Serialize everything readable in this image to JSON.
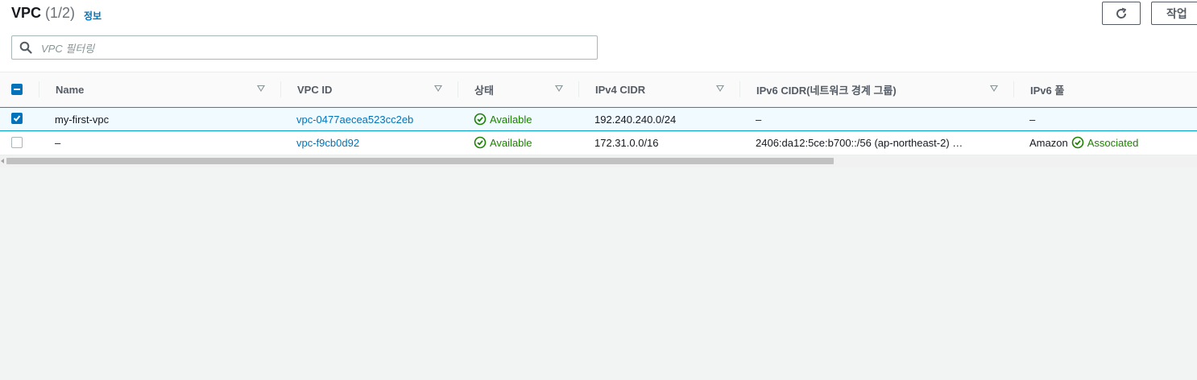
{
  "header": {
    "title": "VPC",
    "count": "(1/2)",
    "info_link": "정보",
    "refresh_icon": "refresh-icon",
    "actions_label": "작업"
  },
  "search": {
    "placeholder": "VPC 필터링",
    "value": ""
  },
  "columns": [
    {
      "label": "Name"
    },
    {
      "label": "VPC ID"
    },
    {
      "label": "상태"
    },
    {
      "label": "IPv4 CIDR"
    },
    {
      "label": "IPv6 CIDR(네트워크 경계 그룹)"
    },
    {
      "label": "IPv6 풀"
    }
  ],
  "rows": [
    {
      "selected": true,
      "name": "my-first-vpc",
      "vpc_id": "vpc-0477aecea523cc2eb",
      "status": "Available",
      "ipv4": "192.240.240.0/24",
      "ipv6": "–",
      "ipv6_pool": "–",
      "ipv6_pool_status": ""
    },
    {
      "selected": false,
      "name": "–",
      "vpc_id": "vpc-f9cb0d92",
      "status": "Available",
      "ipv4": "172.31.0.0/16",
      "ipv6": "2406:da12:5ce:b700::/56 (ap-northeast-2) …",
      "ipv6_pool": "Amazon",
      "ipv6_pool_status": "Associated"
    }
  ],
  "colors": {
    "link": "#0073bb",
    "success": "#1d8102",
    "selected_border": "#00a1c9"
  }
}
